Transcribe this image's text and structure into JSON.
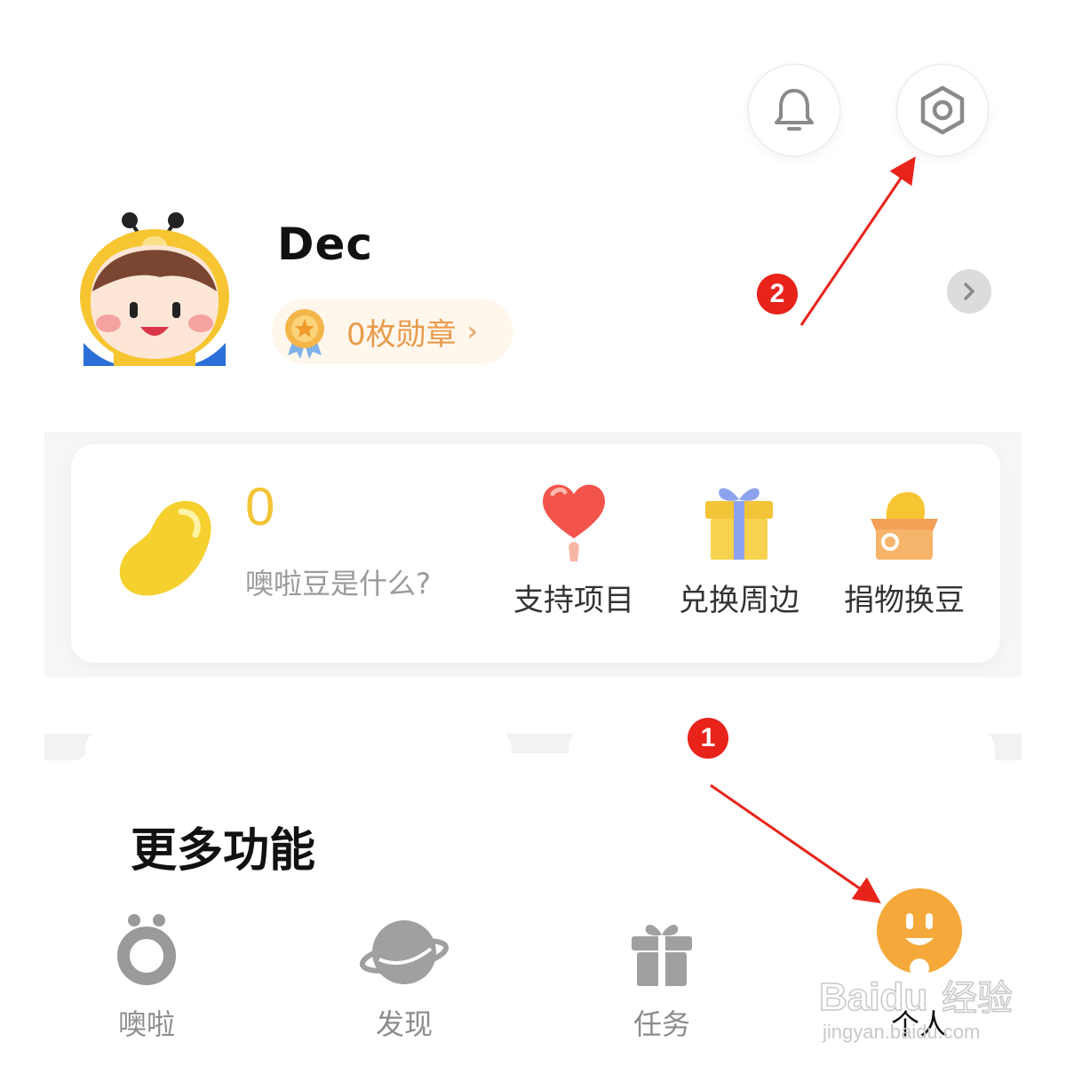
{
  "header": {
    "bell_icon": "bell-icon",
    "settings_icon": "hexagon-gear-icon"
  },
  "profile": {
    "username": "Dec",
    "badge_text": "0枚勋章",
    "badge_chevron": "›"
  },
  "beans": {
    "count": "0",
    "help_text": "噢啦豆是什么?",
    "actions": [
      {
        "label": "支持项目",
        "icon": "heart-balloon-icon"
      },
      {
        "label": "兑换周边",
        "icon": "gift-box-icon"
      },
      {
        "label": "捐物换豆",
        "icon": "donation-box-icon"
      }
    ]
  },
  "more": {
    "title": "更多功能"
  },
  "tabbar": {
    "items": [
      {
        "label": "噢啦",
        "icon": "ola-logo-icon",
        "active": false
      },
      {
        "label": "发现",
        "icon": "planet-icon",
        "active": false
      },
      {
        "label": "任务",
        "icon": "gift-icon",
        "active": false
      },
      {
        "label": "个人",
        "icon": "smiley-face-icon",
        "active": true
      }
    ]
  },
  "annotations": {
    "marker_1": "1",
    "marker_2": "2",
    "color": "#e8231a"
  },
  "watermark": {
    "brand": "Baidu",
    "cn": "经验",
    "url": "jingyan.baidu.com"
  },
  "colors": {
    "accent_yellow": "#f2c437",
    "accent_orange": "#f5a93a",
    "badge_text": "#e99b4c",
    "tab_inactive": "#8c8c8c"
  }
}
